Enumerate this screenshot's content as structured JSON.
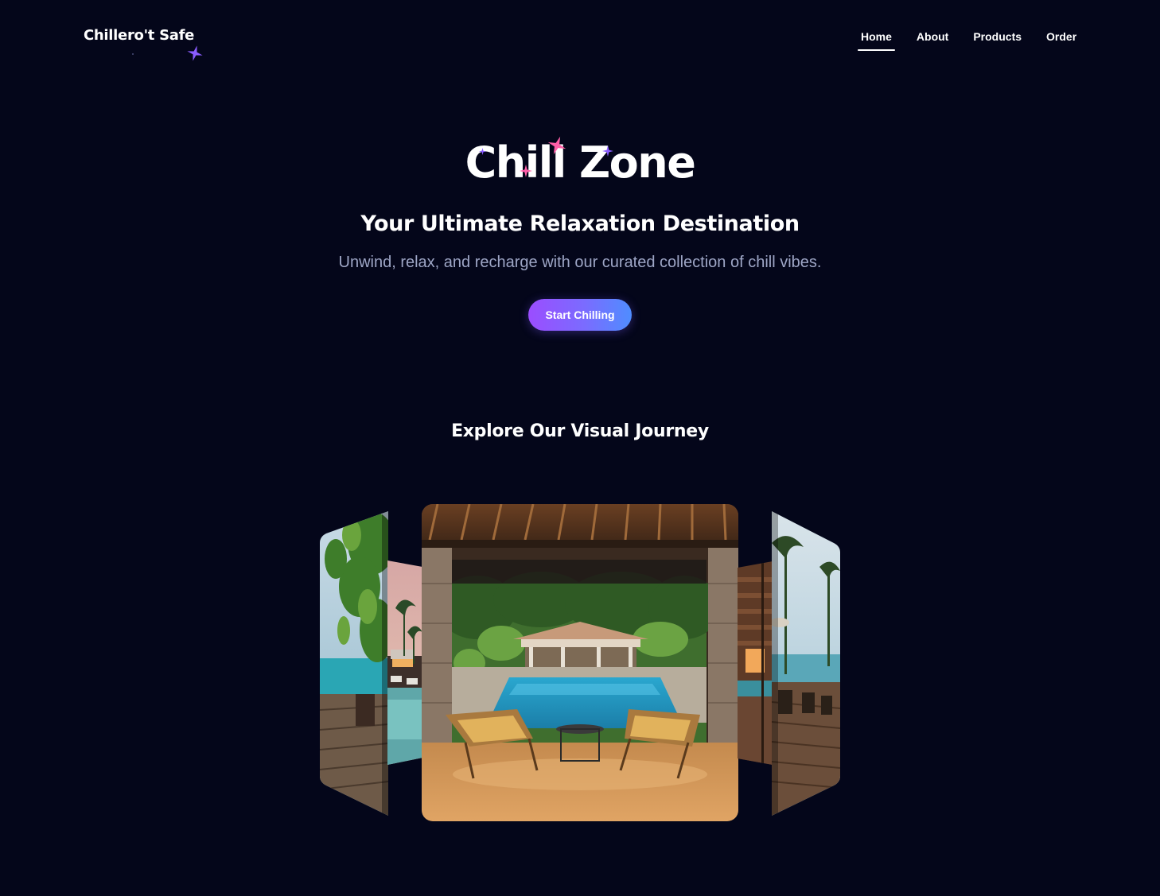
{
  "header": {
    "brand": "Chillero't Safe",
    "nav": [
      {
        "label": "Home",
        "active": true
      },
      {
        "label": "About",
        "active": false
      },
      {
        "label": "Products",
        "active": false
      },
      {
        "label": "Order",
        "active": false
      }
    ]
  },
  "hero": {
    "title": "Chill Zone",
    "subtitle": "Your Ultimate Relaxation Destination",
    "description": "Unwind, relax, and recharge with our curated collection of chill vibes.",
    "cta_label": "Start Chilling"
  },
  "gallery": {
    "title": "Explore Our Visual Journey",
    "slides": [
      {
        "name": "slide-far-left",
        "scene": "overwater-deck-with-trees"
      },
      {
        "name": "slide-left",
        "scene": "resort-pool-with-palms"
      },
      {
        "name": "slide-center",
        "scene": "covered-patio-with-pool-and-chairs"
      },
      {
        "name": "slide-right",
        "scene": "wooden-villa-with-pool"
      },
      {
        "name": "slide-far-right",
        "scene": "pier-with-palms-and-sea"
      }
    ]
  },
  "colors": {
    "background": "#04061a",
    "cta_gradient_start": "#9b4dff",
    "cta_gradient_end": "#4f8dff",
    "description_text": "#9ea6c6",
    "sparkle_pink": "#ff5fa8",
    "sparkle_purple": "#8a5cff"
  },
  "icons": [
    "sparkle-icon"
  ]
}
